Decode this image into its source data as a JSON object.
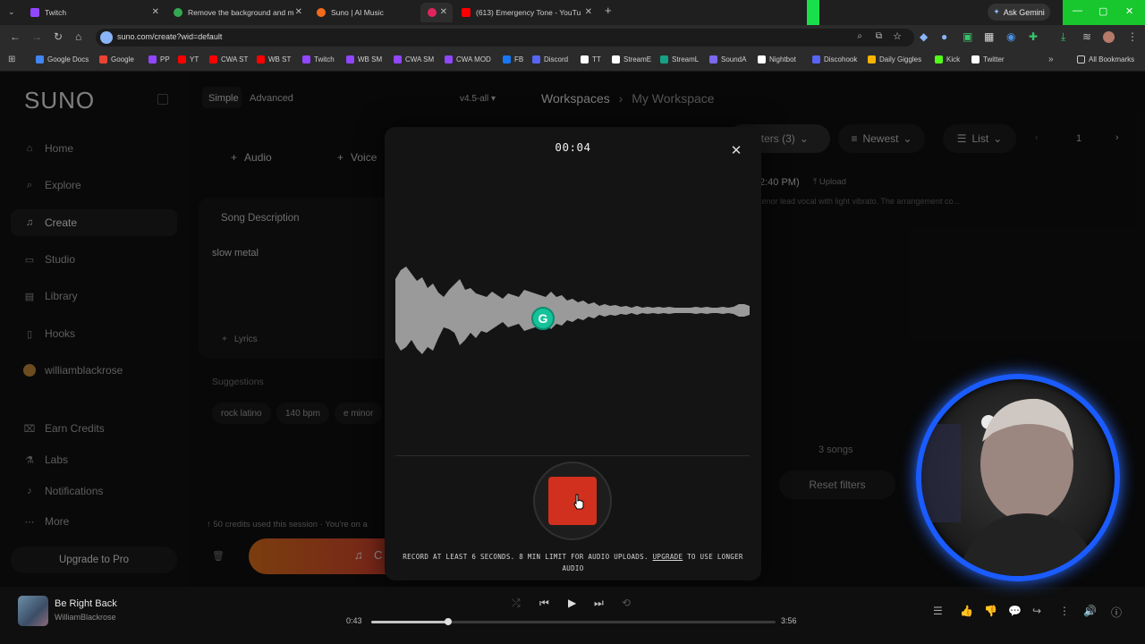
{
  "browser": {
    "tabs": [
      {
        "title": "Twitch",
        "color": "#9146ff"
      },
      {
        "title": "Remove the background and m",
        "color": "#34a853"
      },
      {
        "title": "Suno | AI Music",
        "color": "#f26b1d"
      },
      {
        "title": "",
        "color": "#e0245e"
      },
      {
        "title": "(613) Emergency Tone - YouTu",
        "color": "#ff0000"
      }
    ],
    "new_tab_icon": "plus-icon",
    "ask_gemini": "Ask Gemini",
    "url": "suno.com/create?wid=default",
    "bookmarks": [
      {
        "label": "Google Docs",
        "color": "#4285f4"
      },
      {
        "label": "Google",
        "color": "#ea4335"
      },
      {
        "label": "PP",
        "color": "#9146ff"
      },
      {
        "label": "YT",
        "color": "#ff0000"
      },
      {
        "label": "CWA ST",
        "color": "#ff0000"
      },
      {
        "label": "WB ST",
        "color": "#ff0000"
      },
      {
        "label": "Twitch",
        "color": "#9146ff"
      },
      {
        "label": "WB SM",
        "color": "#9146ff"
      },
      {
        "label": "CWA SM",
        "color": "#9146ff"
      },
      {
        "label": "CWA MOD",
        "color": "#9146ff"
      },
      {
        "label": "FB",
        "color": "#1877f2"
      },
      {
        "label": "Discord",
        "color": "#5865f2"
      },
      {
        "label": "TT",
        "color": "#ffffff"
      },
      {
        "label": "StreamE",
        "color": "#ffffff"
      },
      {
        "label": "StreamL",
        "color": "#16a085"
      },
      {
        "label": "SoundA",
        "color": "#7b68ee"
      },
      {
        "label": "Nightbot",
        "color": "#ffffff"
      },
      {
        "label": "Discohook",
        "color": "#5865f2"
      },
      {
        "label": "Daily Giggles",
        "color": "#f4b400"
      },
      {
        "label": "Kick",
        "color": "#53fc18"
      },
      {
        "label": "Twitter",
        "color": "#ffffff"
      }
    ],
    "all_bookmarks": "All Bookmarks"
  },
  "app": {
    "logo": "SUNO",
    "nav": [
      {
        "label": "Home",
        "icon": "home-icon"
      },
      {
        "label": "Explore",
        "icon": "search-icon"
      },
      {
        "label": "Create",
        "icon": "music-note-icon",
        "active": true
      },
      {
        "label": "Studio",
        "icon": "studio-icon"
      },
      {
        "label": "Library",
        "icon": "library-icon"
      },
      {
        "label": "Hooks",
        "icon": "hooks-icon"
      },
      {
        "label": "williamblackrose",
        "icon": "avatar"
      }
    ],
    "nav2": [
      {
        "label": "Earn Credits",
        "icon": "gift-icon"
      },
      {
        "label": "Labs",
        "icon": "flask-icon"
      },
      {
        "label": "Notifications",
        "icon": "bell-icon"
      },
      {
        "label": "More",
        "icon": "more-icon"
      }
    ],
    "upgrade": "Upgrade to Pro",
    "create": {
      "mode_simple": "Simple",
      "mode_advanced": "Advanced",
      "version": "v4.5-all",
      "audio": "Audio",
      "voice": "Voice",
      "song_description_label": "Song Description",
      "song_description_value": "slow metal",
      "lyrics": "Lyrics",
      "suggestions_label": "Suggestions",
      "chips": [
        "rock latino",
        "140 bpm",
        "e minor"
      ],
      "credits_text": "50 credits used this session",
      "credits_more": "You're on a",
      "create_btn": "C"
    },
    "workspace": {
      "breadcrumb_root": "Workspaces",
      "breadcrumb_current": "My Workspace",
      "filters": "Filters (3)",
      "sort": "Newest",
      "view": "List",
      "page": "1",
      "time_text": "2:40 PM)",
      "upload": "Upload",
      "desc_text": "tenor lead vocal with light vibrato. The arrangement co...",
      "songs_count": "3 songs",
      "reset_filters": "Reset filters"
    }
  },
  "modal": {
    "timer": "00:04",
    "note_pre": "RECORD AT LEAST 6 SECONDS. 8 MIN LIMIT FOR AUDIO UPLOADS. ",
    "note_link": "UPGRADE",
    "note_post": " TO USE LONGER AUDIO",
    "accent": "#d2301f"
  },
  "player": {
    "title": "Be Right Back",
    "artist": "WilliamBlackrose",
    "current": "0:43",
    "total": "3:56",
    "progress": 0.19
  }
}
